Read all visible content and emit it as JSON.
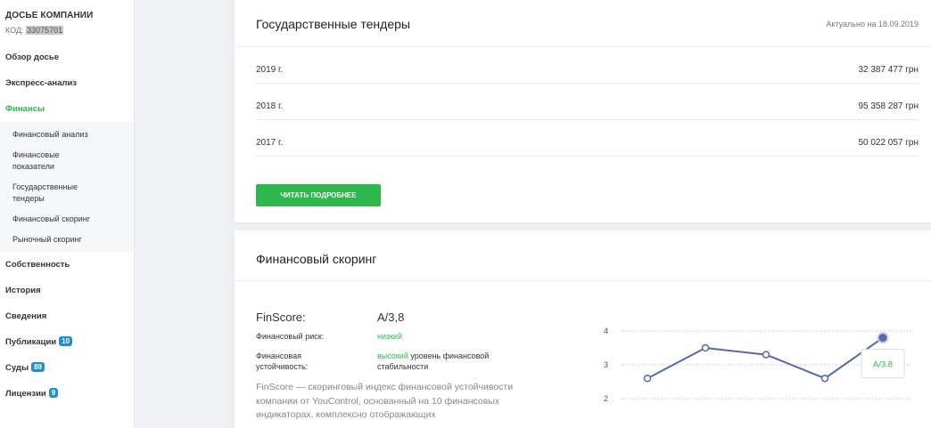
{
  "sidebar": {
    "company_title": "ДОСЬЕ КОМПАНИИ",
    "code_label": "КОД:",
    "code_value": "33075701",
    "nav": [
      {
        "label": "Обзор досье"
      },
      {
        "label": "Экспресс-анализ"
      },
      {
        "label": "Финансы",
        "active": true
      }
    ],
    "submenu": [
      {
        "label": "Финансовый анализ"
      },
      {
        "label1": "Финансовые",
        "label2": "показатели"
      },
      {
        "label1": "Государственные",
        "label2": "тендеры"
      },
      {
        "label": "Финансовый скоринг"
      },
      {
        "label": "Рыночный скоринг"
      }
    ],
    "nav_after": [
      {
        "label": "Собственность"
      },
      {
        "label": "История"
      },
      {
        "label": "Сведения"
      },
      {
        "label": "Публикации",
        "badge": "10"
      },
      {
        "label": "Суды",
        "badge": "89"
      },
      {
        "label": "Лицензии",
        "badge": "9"
      }
    ],
    "accent_color": "#2db84c",
    "badge_color": "#1f8fd0"
  },
  "tenders": {
    "title": "Государственные тендеры",
    "updated": "Актуально на 18.09.2019",
    "rows": [
      {
        "year": "2019 г.",
        "amount": "32 387 477 грн"
      },
      {
        "year": "2018 г.",
        "amount": "95 358 287 грн"
      },
      {
        "year": "2017 г.",
        "amount": "50 022 057 грн"
      }
    ],
    "button_label": "ЧИТАТЬ ПОДРОБНЕЕ"
  },
  "scoring": {
    "title": "Финансовый скоринг",
    "finscore_label": "FinScore:",
    "finscore_value": "A/3,8",
    "risk_label": "Финансовый риск:",
    "risk_value": "низкий",
    "stability_label1": "Финансовая",
    "stability_label2": "устойчивость:",
    "stability_value_green": "высокий",
    "stability_value_rest1": " уровень финансовой",
    "stability_value_rest2": "стабильности",
    "description": "FinScore — скоринговый индекс финансовой устойчивости компании от YouControl, основанный на 10 финансовых индикаторах, комплексно отображающих"
  },
  "chart_data": {
    "type": "line",
    "y_ticks": [
      "4",
      "3",
      "2"
    ],
    "ylim": [
      2,
      4
    ],
    "values": [
      2.6,
      3.5,
      3.3,
      2.6,
      3.8
    ],
    "highlight_label": "A/3.8",
    "line_color": "#5567b3"
  }
}
